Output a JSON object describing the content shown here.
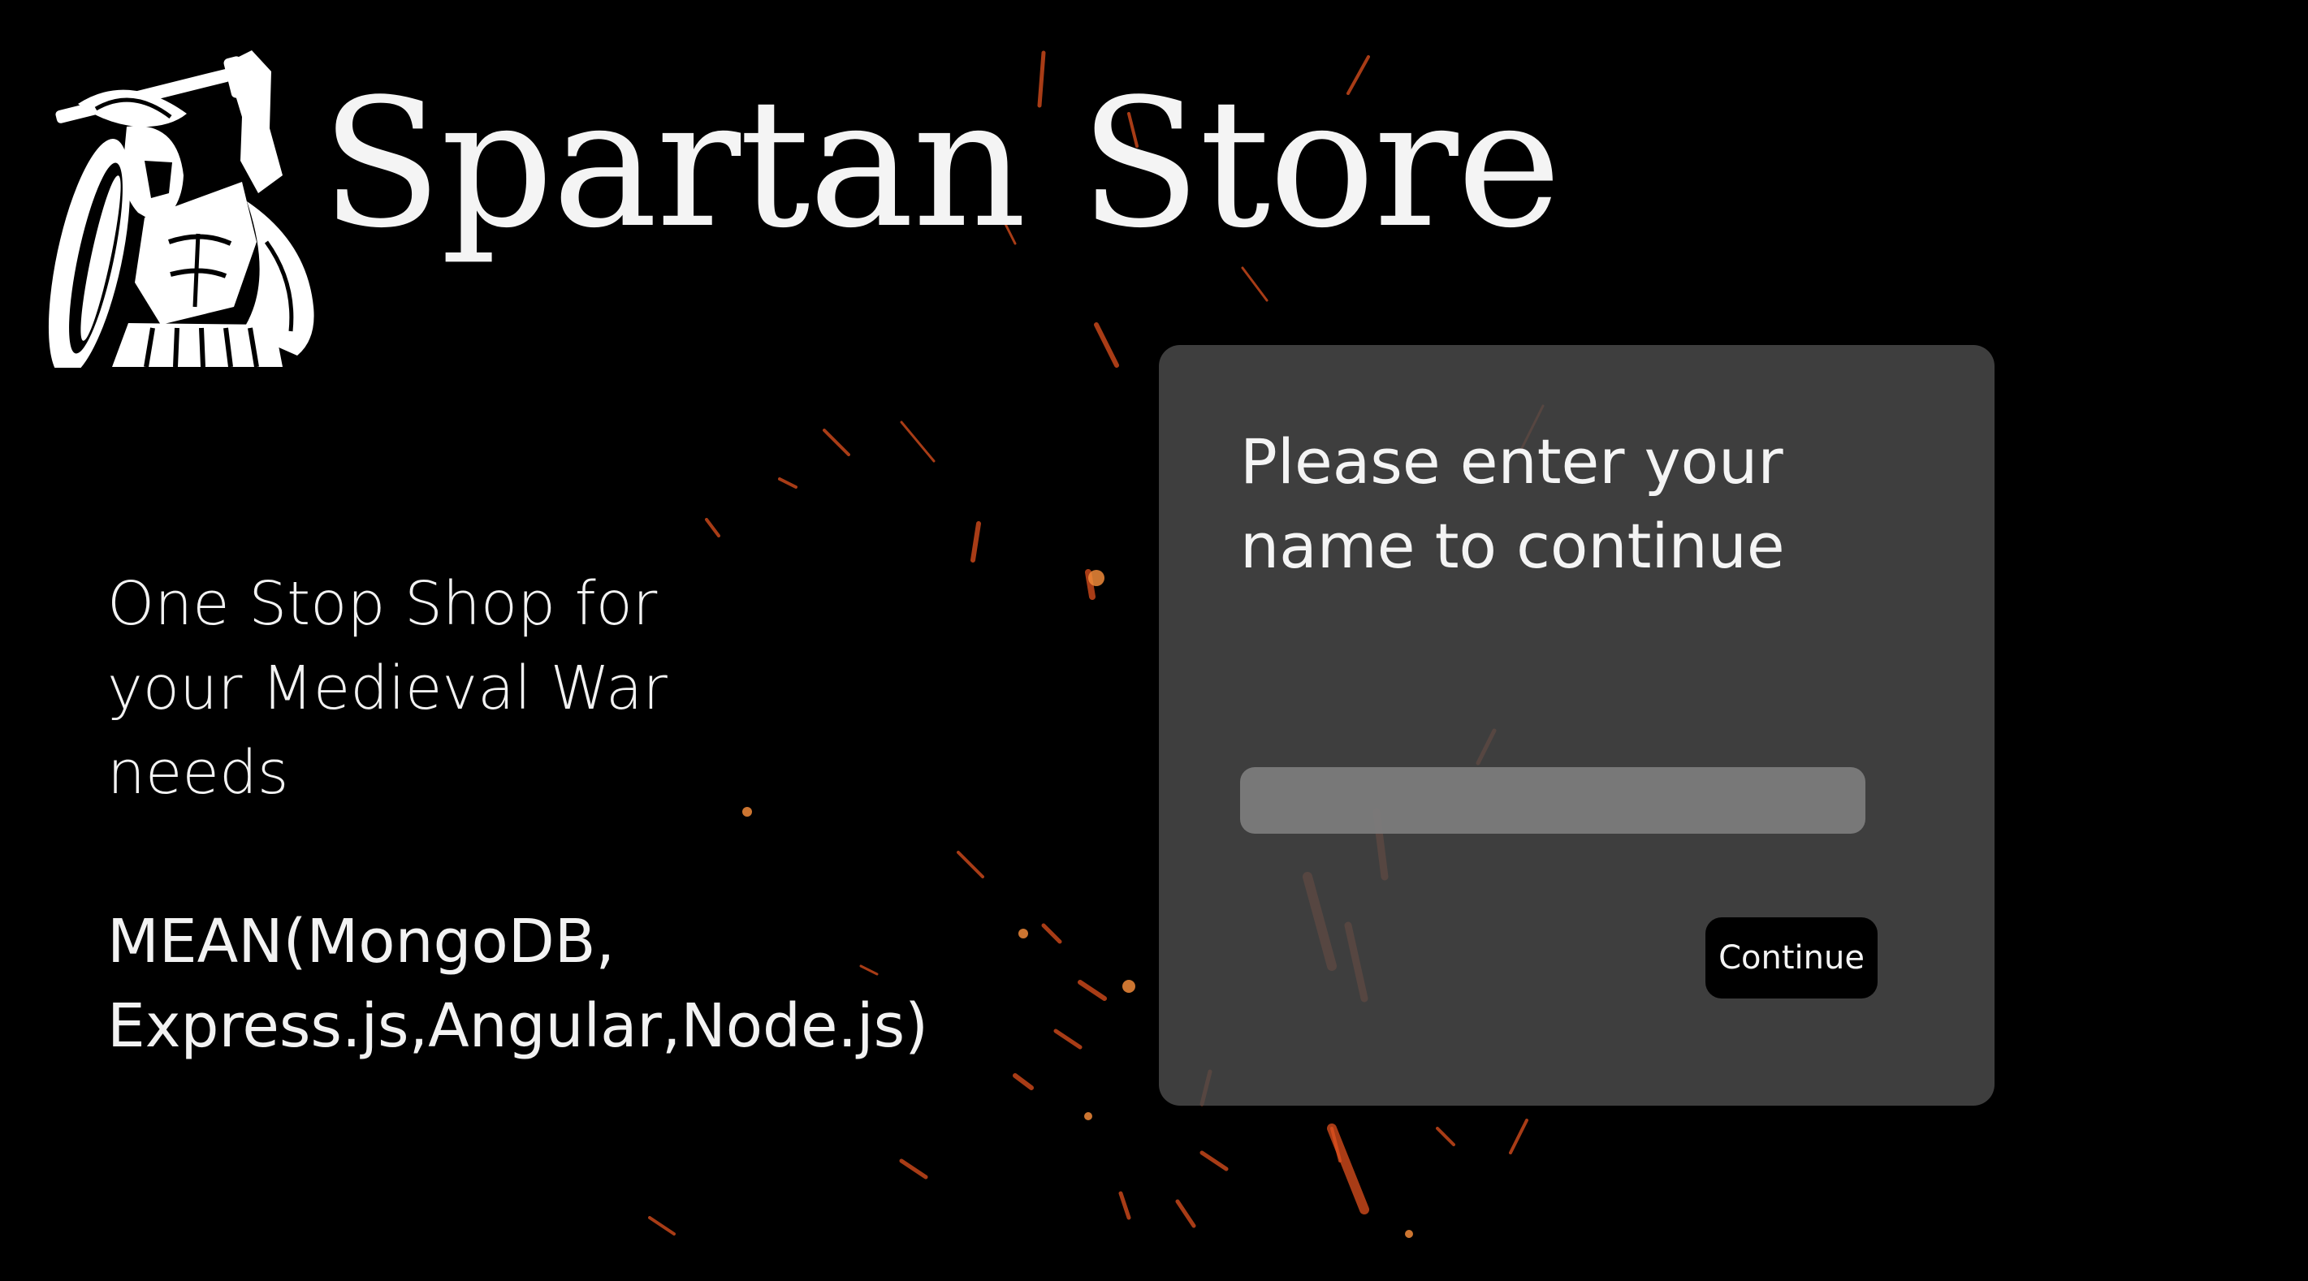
{
  "brand": {
    "title": "Spartan Store",
    "logo_icon": "spartan-warrior-icon"
  },
  "hero": {
    "tagline": "One Stop Shop for your Medieval War needs",
    "stack": "MEAN(MongoDB, Express.js,Angular,Node.js)"
  },
  "card": {
    "heading": "Please enter your name to continue",
    "input_value": "",
    "input_placeholder": "",
    "continue_label": "Continue"
  },
  "colors": {
    "background": "#000000",
    "card": "#484848",
    "input": "#7d7d7d",
    "button": "#000000",
    "text": "#f4f4f4",
    "spark": "#e0511e"
  }
}
